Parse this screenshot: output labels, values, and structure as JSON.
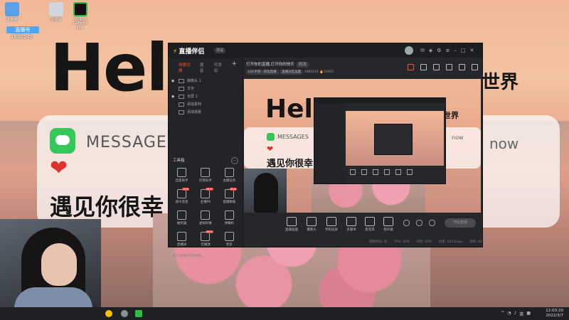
{
  "desktop": {
    "icons": [
      {
        "label": "此电脑",
        "color": "#5aa0e6"
      },
      {
        "label": "回收站",
        "color": "#d0d6e0"
      },
      {
        "label": "NVIDIA GeForce Exp.",
        "color": "#2fbf3a"
      }
    ],
    "overlay_label": "直播号",
    "overlay_number": "1880145"
  },
  "wallpaper": {
    "hello": "Hel",
    "world_cn": "世界",
    "msg_title": "MESSAGES",
    "msg_time": "now",
    "heart": "❤",
    "cn_text": "遇见你很幸"
  },
  "app": {
    "logo": "直播伴侣",
    "version": "测试",
    "left_tabs": [
      "场景切换",
      "混音",
      "可添加"
    ],
    "scenes": [
      "摄像头 1",
      "文字",
      "全屏 1",
      "添加素材",
      "添加场景"
    ],
    "tools_header": "工具箱",
    "tools": [
      {
        "label": "连麦助手",
        "badge": ""
      },
      {
        "label": "房管助手",
        "badge": ""
      },
      {
        "label": "主播任务",
        "badge": ""
      },
      {
        "label": "观众连麦",
        "badge": "NEW"
      },
      {
        "label": "主播PK",
        "badge": "NEW"
      },
      {
        "label": "直播数据",
        "badge": "NEW"
      },
      {
        "label": "抽奖器",
        "badge": ""
      },
      {
        "label": "虚拟形象",
        "badge": ""
      },
      {
        "label": "弹幕机",
        "badge": ""
      },
      {
        "label": "直播间",
        "badge": ""
      },
      {
        "label": "云播放",
        "badge": "NEW"
      },
      {
        "label": "更多",
        "badge": ""
      }
    ],
    "newbie": "新人直播间攻略教程",
    "stream_title": "打开你的直播,打开你的快乐",
    "stream_tag": "修改",
    "sub_line": {
      "category": "LOL手游 · 排位直播",
      "pill": "直播分区设置",
      "room": "1880145",
      "views": "15005"
    },
    "preview": {
      "hello": "Hello",
      "world_cn": "世界",
      "msg_title": "MESSAGES",
      "msg_time": "now",
      "heart": "❤",
      "cn_text": "遇见你很幸"
    },
    "controls": [
      "直播画面",
      "摄像头",
      "手机投屏",
      "多媒体",
      "麦克风",
      "扬声器"
    ],
    "go_live": "开始直播",
    "status": [
      "网络状态: 优",
      "CPU: 28%",
      "内存: 45%",
      "码率: 4852kbps",
      "帧率: 60"
    ]
  },
  "taskbar": {
    "tray_lang": "英",
    "clock_time": "12:03:20",
    "clock_date": "2022/3/7"
  }
}
